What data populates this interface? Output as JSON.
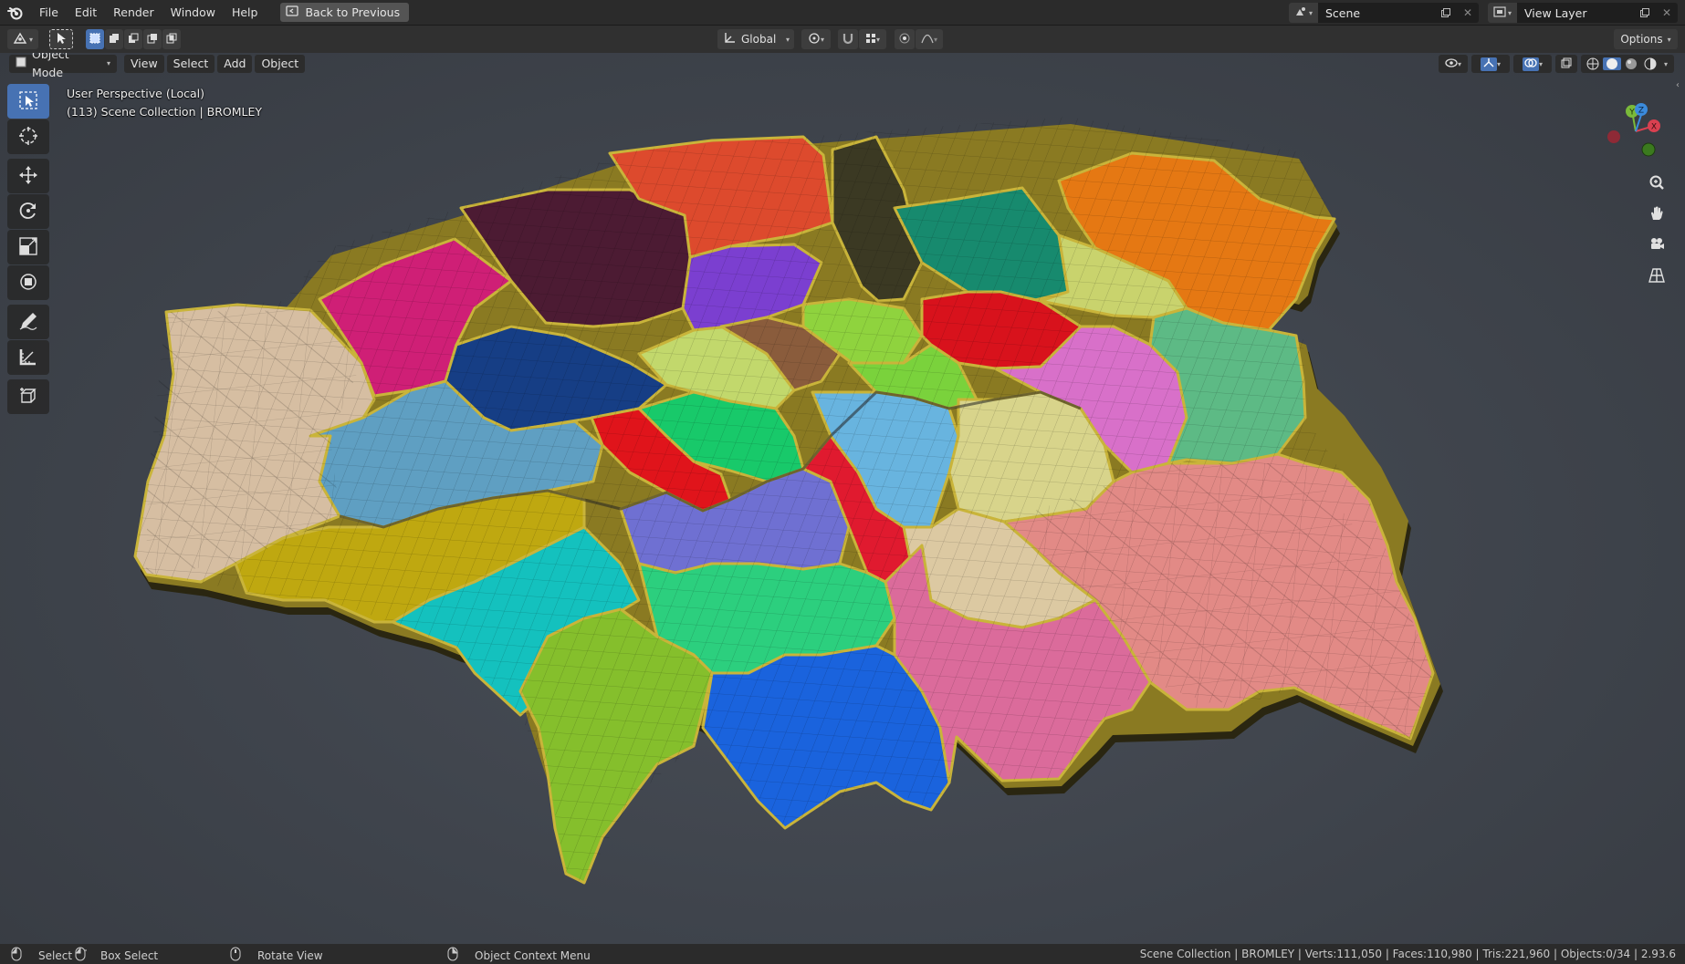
{
  "menubar": {
    "items": [
      "File",
      "Edit",
      "Render",
      "Window",
      "Help"
    ],
    "back_label": "Back to Previous",
    "scene_name": "Scene",
    "view_layer": "View Layer"
  },
  "toolheader": {
    "orientation": "Global",
    "options_label": "Options"
  },
  "viewport_header": {
    "mode": "Object Mode",
    "menus": [
      "View",
      "Select",
      "Add",
      "Object"
    ]
  },
  "viewport": {
    "perspective_label": "User Perspective (Local)",
    "collection_label": "(113) Scene Collection | BROMLEY",
    "gizmo_axes": [
      "X",
      "Y",
      "Z"
    ]
  },
  "left_tools": [
    "select-box",
    "cursor",
    "move",
    "rotate",
    "scale",
    "transform",
    "annotate",
    "measure",
    "add-cube"
  ],
  "right_nav": [
    "zoom",
    "pan",
    "camera",
    "ortho-grid"
  ],
  "statusbar": {
    "hints": [
      {
        "icon": "mouse-left-icon",
        "label": "Select"
      },
      {
        "icon": "mouse-left-drag-icon",
        "label": "Box Select"
      },
      {
        "icon": "mouse-middle-icon",
        "label": "Rotate View"
      },
      {
        "icon": "mouse-right-icon",
        "label": "Object Context Menu"
      }
    ],
    "stats": "Scene Collection | BROMLEY | Verts:111,050 | Faces:110,980 | Tris:221,960 | Objects:0/34 | 2.93.6"
  },
  "colors": {
    "accent": "#4772b3",
    "header_bg": "#303030",
    "viewport_bg": "#41464e",
    "map_edge": "#c9b43a"
  }
}
